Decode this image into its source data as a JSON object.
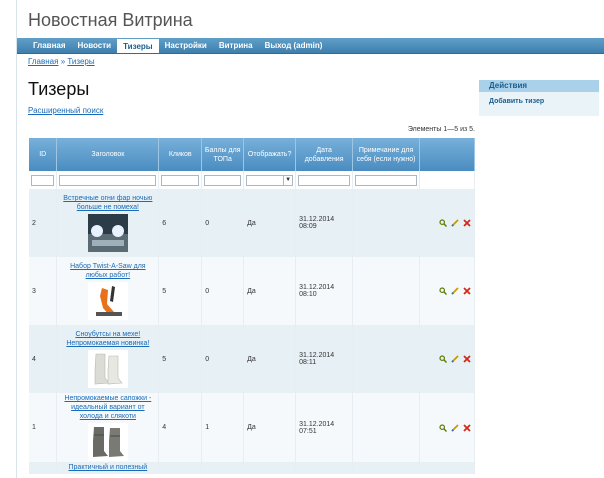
{
  "site": {
    "title": "Новостная Витрина"
  },
  "nav": {
    "items": [
      {
        "label": "Главная"
      },
      {
        "label": "Новости"
      },
      {
        "label": "Тизеры",
        "active": true
      },
      {
        "label": "Настройки"
      },
      {
        "label": "Витрина"
      },
      {
        "label": "Выход (admin)"
      }
    ]
  },
  "breadcrumb": {
    "home": "Главная",
    "separator": "»",
    "current": "Тизеры"
  },
  "page": {
    "heading": "Тизеры",
    "advanced_search": "Расширенный поиск",
    "summary": "Элементы 1—5 из 5."
  },
  "table": {
    "headers": {
      "id": "ID",
      "title": "Заголовок",
      "clicks": "Кликов",
      "score": "Баллы для ТОПа",
      "show": "Отображать?",
      "date": "Дата добавления",
      "note": "Примечание для себя (если нужно)"
    },
    "rows": [
      {
        "id": "2",
        "title": "Встречные огни фар ночью больше не помеха!",
        "clicks": "6",
        "score": "0",
        "show": "Да",
        "date": "31.12.2014 08:09",
        "note": "",
        "image": "headlights"
      },
      {
        "id": "3",
        "title": "Набор Twist-A-Saw для любых работ!",
        "clicks": "5",
        "score": "0",
        "show": "Да",
        "date": "31.12.2014 08:10",
        "note": "",
        "image": "saw"
      },
      {
        "id": "4",
        "title": "Сноубутсы на мехе! Непромокаемая новинка!",
        "clicks": "5",
        "score": "0",
        "show": "Да",
        "date": "31.12.2014 08:11",
        "note": "",
        "image": "white-boots"
      },
      {
        "id": "1",
        "title": "Непромокаемые сапожки - идеальный вариант от холода и слякоти",
        "clicks": "4",
        "score": "1",
        "show": "Да",
        "date": "31.12.2014 07:51",
        "note": "",
        "image": "gray-boots"
      }
    ],
    "partial_row_title": "Практичный и полезный"
  },
  "sidebar": {
    "heading": "Действия",
    "add_link": "Добавить тизер"
  },
  "colors": {
    "accent": "#3e7fae",
    "header": "#5f9fc8",
    "link": "#1a6bb8"
  }
}
